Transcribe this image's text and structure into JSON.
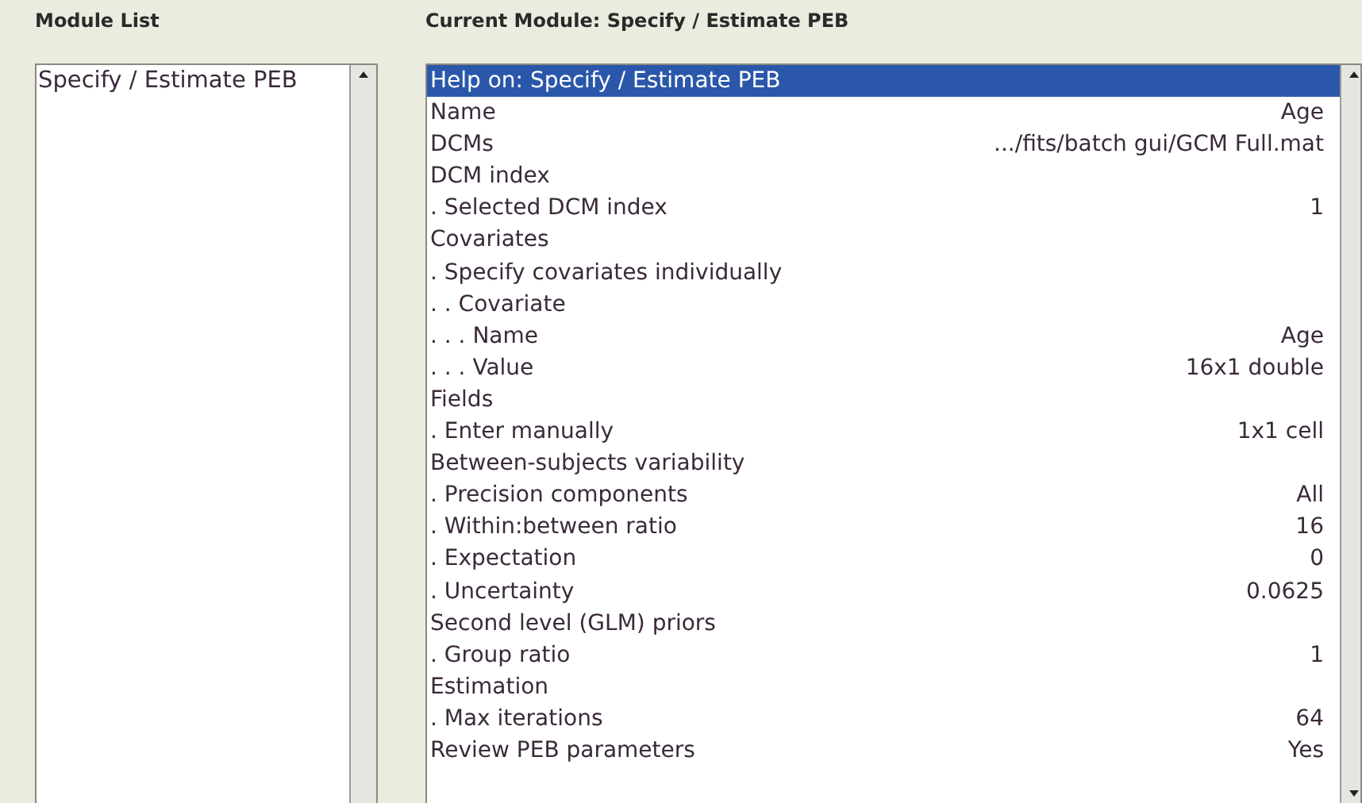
{
  "module_list": {
    "title": "Module List",
    "items": [
      {
        "label": "Specify / Estimate PEB",
        "selected": false
      }
    ]
  },
  "current_module": {
    "title": "Current Module: Specify / Estimate PEB",
    "rows": [
      {
        "label": "Help on: Specify / Estimate PEB",
        "selected": true
      },
      {
        "label": "Name",
        "value": "Age",
        "selected": false
      },
      {
        "label": "DCMs",
        "value": ".../fits/batch gui/GCM Full.mat",
        "selected": false
      },
      {
        "label": "DCM index",
        "selected": false
      },
      {
        "label": ". Selected DCM index",
        "value": "1",
        "selected": false
      },
      {
        "label": "Covariates",
        "selected": false
      },
      {
        "label": ". Specify covariates individually",
        "selected": false
      },
      {
        "label": ". . Covariate",
        "selected": false
      },
      {
        "label": ". . . Name",
        "value": "Age",
        "selected": false
      },
      {
        "label": ". . . Value",
        "value": "16x1 double",
        "selected": false
      },
      {
        "label": "Fields",
        "selected": false
      },
      {
        "label": ". Enter manually",
        "value": "1x1 cell",
        "selected": false
      },
      {
        "label": "Between-subjects variability",
        "selected": false
      },
      {
        "label": ". Precision components",
        "value": "All",
        "selected": false
      },
      {
        "label": ". Within:between ratio",
        "value": "16",
        "selected": false
      },
      {
        "label": ". Expectation",
        "value": "0",
        "selected": false
      },
      {
        "label": ". Uncertainty",
        "value": "0.0625",
        "selected": false
      },
      {
        "label": "Second level (GLM) priors",
        "selected": false
      },
      {
        "label": ". Group ratio",
        "value": "1",
        "selected": false
      },
      {
        "label": "Estimation",
        "selected": false
      },
      {
        "label": ". Max iterations",
        "value": "64",
        "selected": false
      },
      {
        "label": "Review PEB parameters",
        "value": "Yes",
        "selected": false
      }
    ]
  }
}
